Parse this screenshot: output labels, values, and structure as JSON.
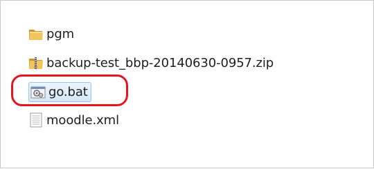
{
  "files": [
    {
      "name": "pgm",
      "icon": "folder-icon",
      "selected": false
    },
    {
      "name": "backup-test_bbp-20140630-0957.zip",
      "icon": "zip-folder-icon",
      "selected": false
    },
    {
      "name": "go.bat",
      "icon": "batch-file-icon",
      "selected": true
    },
    {
      "name": "moodle.xml",
      "icon": "text-file-icon",
      "selected": false
    }
  ],
  "colors": {
    "highlight_ring": "#e8141c",
    "selection_fill": "#d4e8f9",
    "selection_border": "#98c2e6",
    "folder": "#e8b84a"
  }
}
